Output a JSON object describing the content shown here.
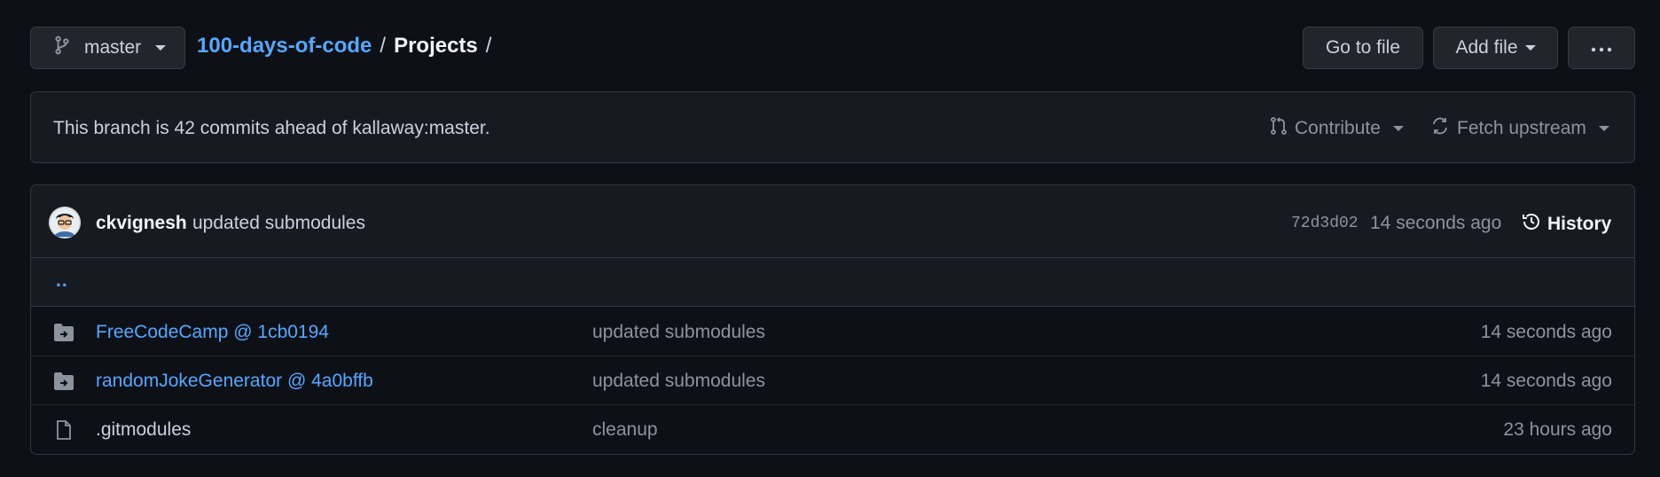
{
  "header": {
    "branch_label": "master",
    "repo_name": "100-days-of-code",
    "separator": "/",
    "current_dir": "Projects",
    "trailing_separator": "/",
    "go_to_file_label": "Go to file",
    "add_file_label": "Add file",
    "more_label": "···"
  },
  "branch_status": {
    "message": "This branch is 42 commits ahead of kallaway:master.",
    "contribute_label": "Contribute",
    "fetch_label": "Fetch upstream"
  },
  "latest_commit": {
    "author": "ckvignesh",
    "message": "updated submodules",
    "sha": "72d3d02",
    "time": "14 seconds ago",
    "history_label": "History"
  },
  "parent_dir_label": "..",
  "files": [
    {
      "name": "FreeCodeCamp @ 1cb0194",
      "type": "submodule",
      "message": "updated submodules",
      "time": "14 seconds ago"
    },
    {
      "name": "randomJokeGenerator @ 4a0bffb",
      "type": "submodule",
      "message": "updated submodules",
      "time": "14 seconds ago"
    },
    {
      "name": ".gitmodules",
      "type": "file",
      "message": "cleanup",
      "time": "23 hours ago"
    }
  ],
  "colors": {
    "background": "#0d1117",
    "link": "#58a6ff",
    "muted": "#8b949e",
    "text": "#c9d1d9"
  },
  "icons": [
    "git-branch-icon",
    "caret-down-icon",
    "kebab-horizontal-icon",
    "git-pull-request-icon",
    "sync-icon",
    "history-icon",
    "submodule-folder-icon",
    "file-icon"
  ]
}
